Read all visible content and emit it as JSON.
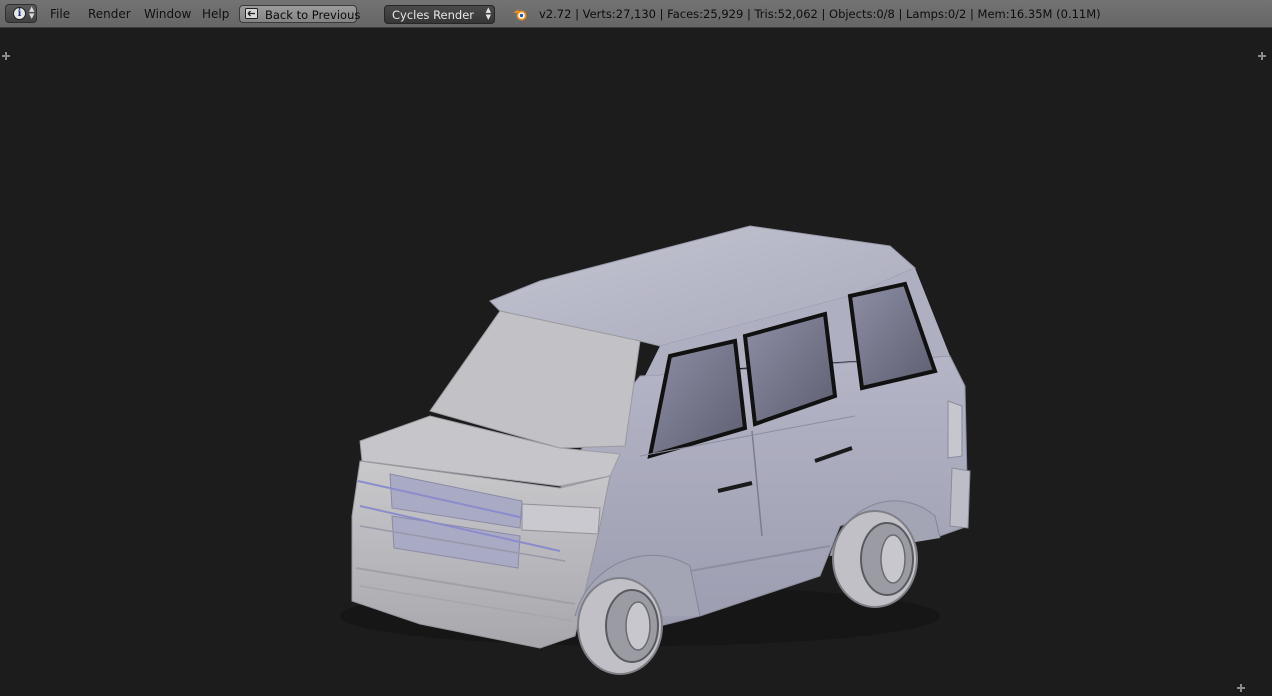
{
  "header": {
    "editor_type_icon": "info-icon",
    "menu": {
      "file": "File",
      "render": "Render",
      "window": "Window",
      "help": "Help"
    },
    "back_button": {
      "label": "Back to Previous",
      "icon": "back-screen-icon"
    },
    "render_engine": {
      "selected": "Cycles Render"
    },
    "logo_icon": "blender-logo-icon",
    "stats": "v2.72 | Verts:27,130 | Faces:25,929 | Tris:52,062 | Objects:0/8 | Lamps:0/2 | Mem:16.35M (0.11M)"
  },
  "viewport": {
    "background_color": "#1c1c1c",
    "model_color": "#b9bac8",
    "window_color": "#6e6e80",
    "corner_widget_icon": "plus-icon"
  }
}
